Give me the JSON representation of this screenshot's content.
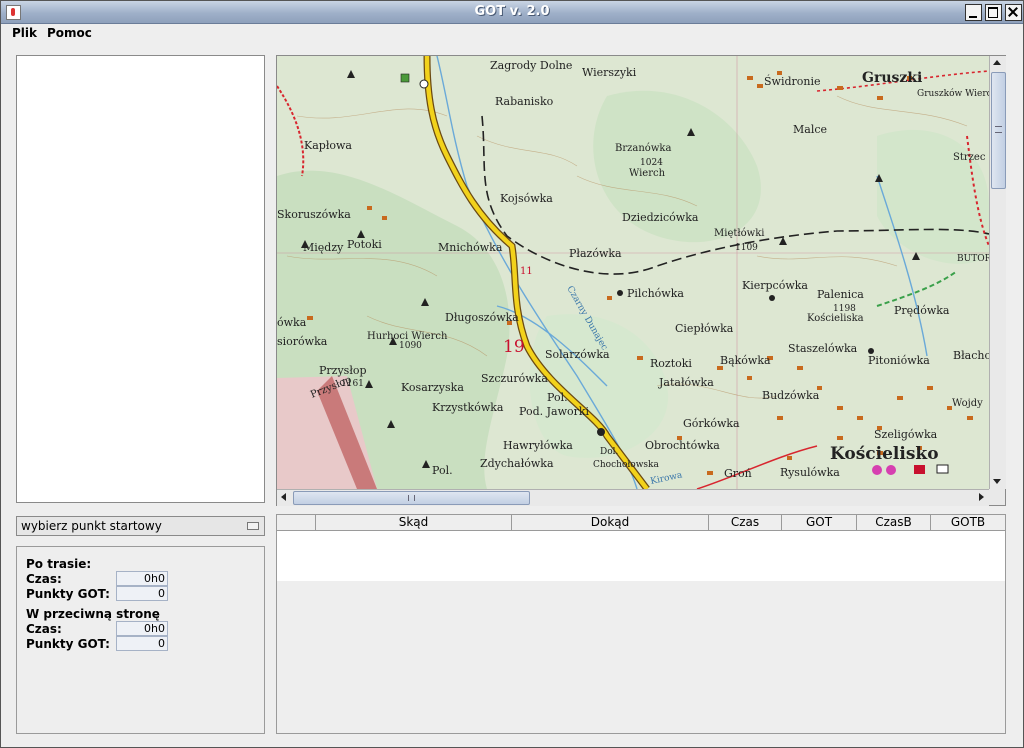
{
  "window": {
    "title": "GOT v. 2.0"
  },
  "menu": {
    "items": [
      "Plik",
      "Pomoc"
    ]
  },
  "start_combo": {
    "value": "wybierz punkt startowy"
  },
  "stats": {
    "forward_header": "Po trasie:",
    "time_label": "Czas:",
    "time_value": "0h0",
    "points_label": "Punkty GOT:",
    "points_value": "0",
    "reverse_header": "W przeciwną stronę",
    "rev_time_label": "Czas:",
    "rev_time_value": "0h0",
    "rev_points_label": "Punkty GOT:",
    "rev_points_value": "0"
  },
  "table": {
    "columns": [
      "",
      "Skąd",
      "Dokąd",
      "Czas",
      "GOT",
      "CzasB",
      "GOTB"
    ],
    "rows": []
  },
  "map": {
    "colors": {
      "road": "#f2d21b",
      "trail_red": "#d8262f",
      "trail_green": "#3aa04a",
      "forest": "#cfe3c6",
      "village": "#c86a1e",
      "river": "#6aa9d8"
    },
    "labels": {
      "zagrodzka": "Zagrody Dolne",
      "wierszyki": "Wierszyki",
      "rabanisko": "Rabanisko",
      "swidronie": "Świdronie",
      "gruszki": "Gruszki",
      "gruszkow": "Gruszków Wierch",
      "kaplowa": "Kapłowa",
      "brzanowka": "Brzanówka",
      "h1024": "1024",
      "wierch": "Wierch",
      "malce": "Malce",
      "strzec": "Strzec",
      "kojsowka": "Kojsówka",
      "skoruszowka": "Skoruszówka",
      "dziedzicowka": "Dziedzicówka",
      "mietlowki": "Miętłówki",
      "miedzy": "Między",
      "potoki": "Potoki",
      "mnichowka": "Mnichówka",
      "plazowka": "Płazówka",
      "h1109": "1109",
      "butor": "BUTOR",
      "pilchowka": "Pilchówka",
      "kierpcowka": "Kierpcówka",
      "palenica": "Palenica",
      "koscieliska": "Kościeliska",
      "h1198": "1198",
      "predowka": "Prędówka",
      "dlugoszowka": "Długoszówka",
      "hurhoci": "Hurhoci Wierch",
      "h1090": "1090",
      "road11": "11",
      "num19": "19",
      "cieplowka": "Ciepłówka",
      "siorowka": "siorówka",
      "owka": "ówka",
      "solarzowka": "Solarzówka",
      "rostoki": "Roztoki",
      "bakowka": "Bąkówka",
      "staszelowka": "Staszelówka",
      "pitoniowka": "Pitoniówka",
      "blacho": "Błacho",
      "przyslop": "Przysłop",
      "h1161": "1161",
      "przyslop2": "Przysłop",
      "kosarzyska": "Kosarzyska",
      "szczurowka": "Szczurówka",
      "jatalowka": "Jatałówka",
      "budzowka": "Budzówka",
      "krzystkowka": "Krzystkówka",
      "pol": "Pol.",
      "podjaworki": "Pod. Jaworki",
      "wojdy": "Wojdy",
      "szeligowka": "Szeligówka",
      "gorkowka": "Górkówka",
      "hawrylowka": "Hawryłówka",
      "obrochtowka": "Obrochtówka",
      "koscielisko": "Kościelisko",
      "dol": "Dol.",
      "chocholowska": "Chochołowska",
      "zdychalowka": "Zdychałówka",
      "pol2": "Pol.",
      "gron": "Groń",
      "rysulowka": "Rysulówka",
      "kirowa": "Kirowa",
      "dunajec": "Czarny Dunajec"
    }
  }
}
